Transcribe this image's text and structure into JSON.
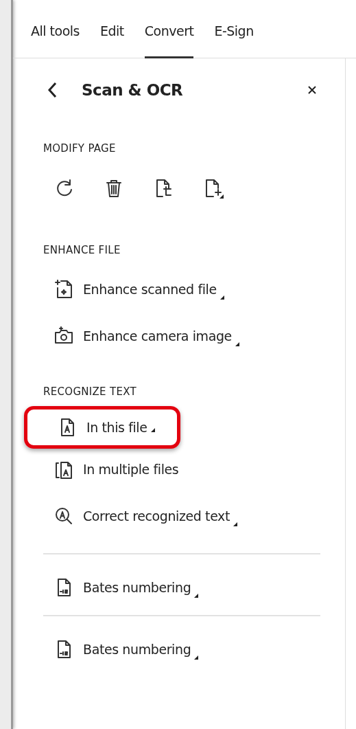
{
  "tabs": [
    {
      "label": "All tools",
      "selected": false
    },
    {
      "label": "Edit",
      "selected": false
    },
    {
      "label": "Convert",
      "selected": true
    },
    {
      "label": "E-Sign",
      "selected": false
    }
  ],
  "panel": {
    "title": "Scan & OCR"
  },
  "sections": [
    {
      "heading": "MODIFY PAGE",
      "kind": "icons",
      "tools": [
        {
          "menu": false
        },
        {
          "menu": false
        },
        {
          "menu": false
        },
        {
          "menu": true
        }
      ]
    },
    {
      "heading": "ENHANCE FILE",
      "kind": "list",
      "items": [
        {
          "label": "Enhance scanned file",
          "menu": true,
          "highlighted": false
        },
        {
          "label": "Enhance camera image",
          "menu": true,
          "highlighted": false
        }
      ]
    },
    {
      "heading": "RECOGNIZE TEXT",
      "kind": "list",
      "items": [
        {
          "label": "In this file",
          "menu": true,
          "highlighted": true
        },
        {
          "label": "In multiple files",
          "menu": false,
          "highlighted": false
        },
        {
          "label": "Correct recognized text",
          "menu": true,
          "highlighted": false
        }
      ]
    },
    {
      "kind": "list",
      "items": [
        {
          "label": "Bates numbering",
          "menu": true,
          "highlighted": false
        }
      ]
    },
    {
      "kind": "list",
      "items": [
        {
          "label": "Bates numbering",
          "menu": true,
          "highlighted": false
        }
      ]
    }
  ]
}
